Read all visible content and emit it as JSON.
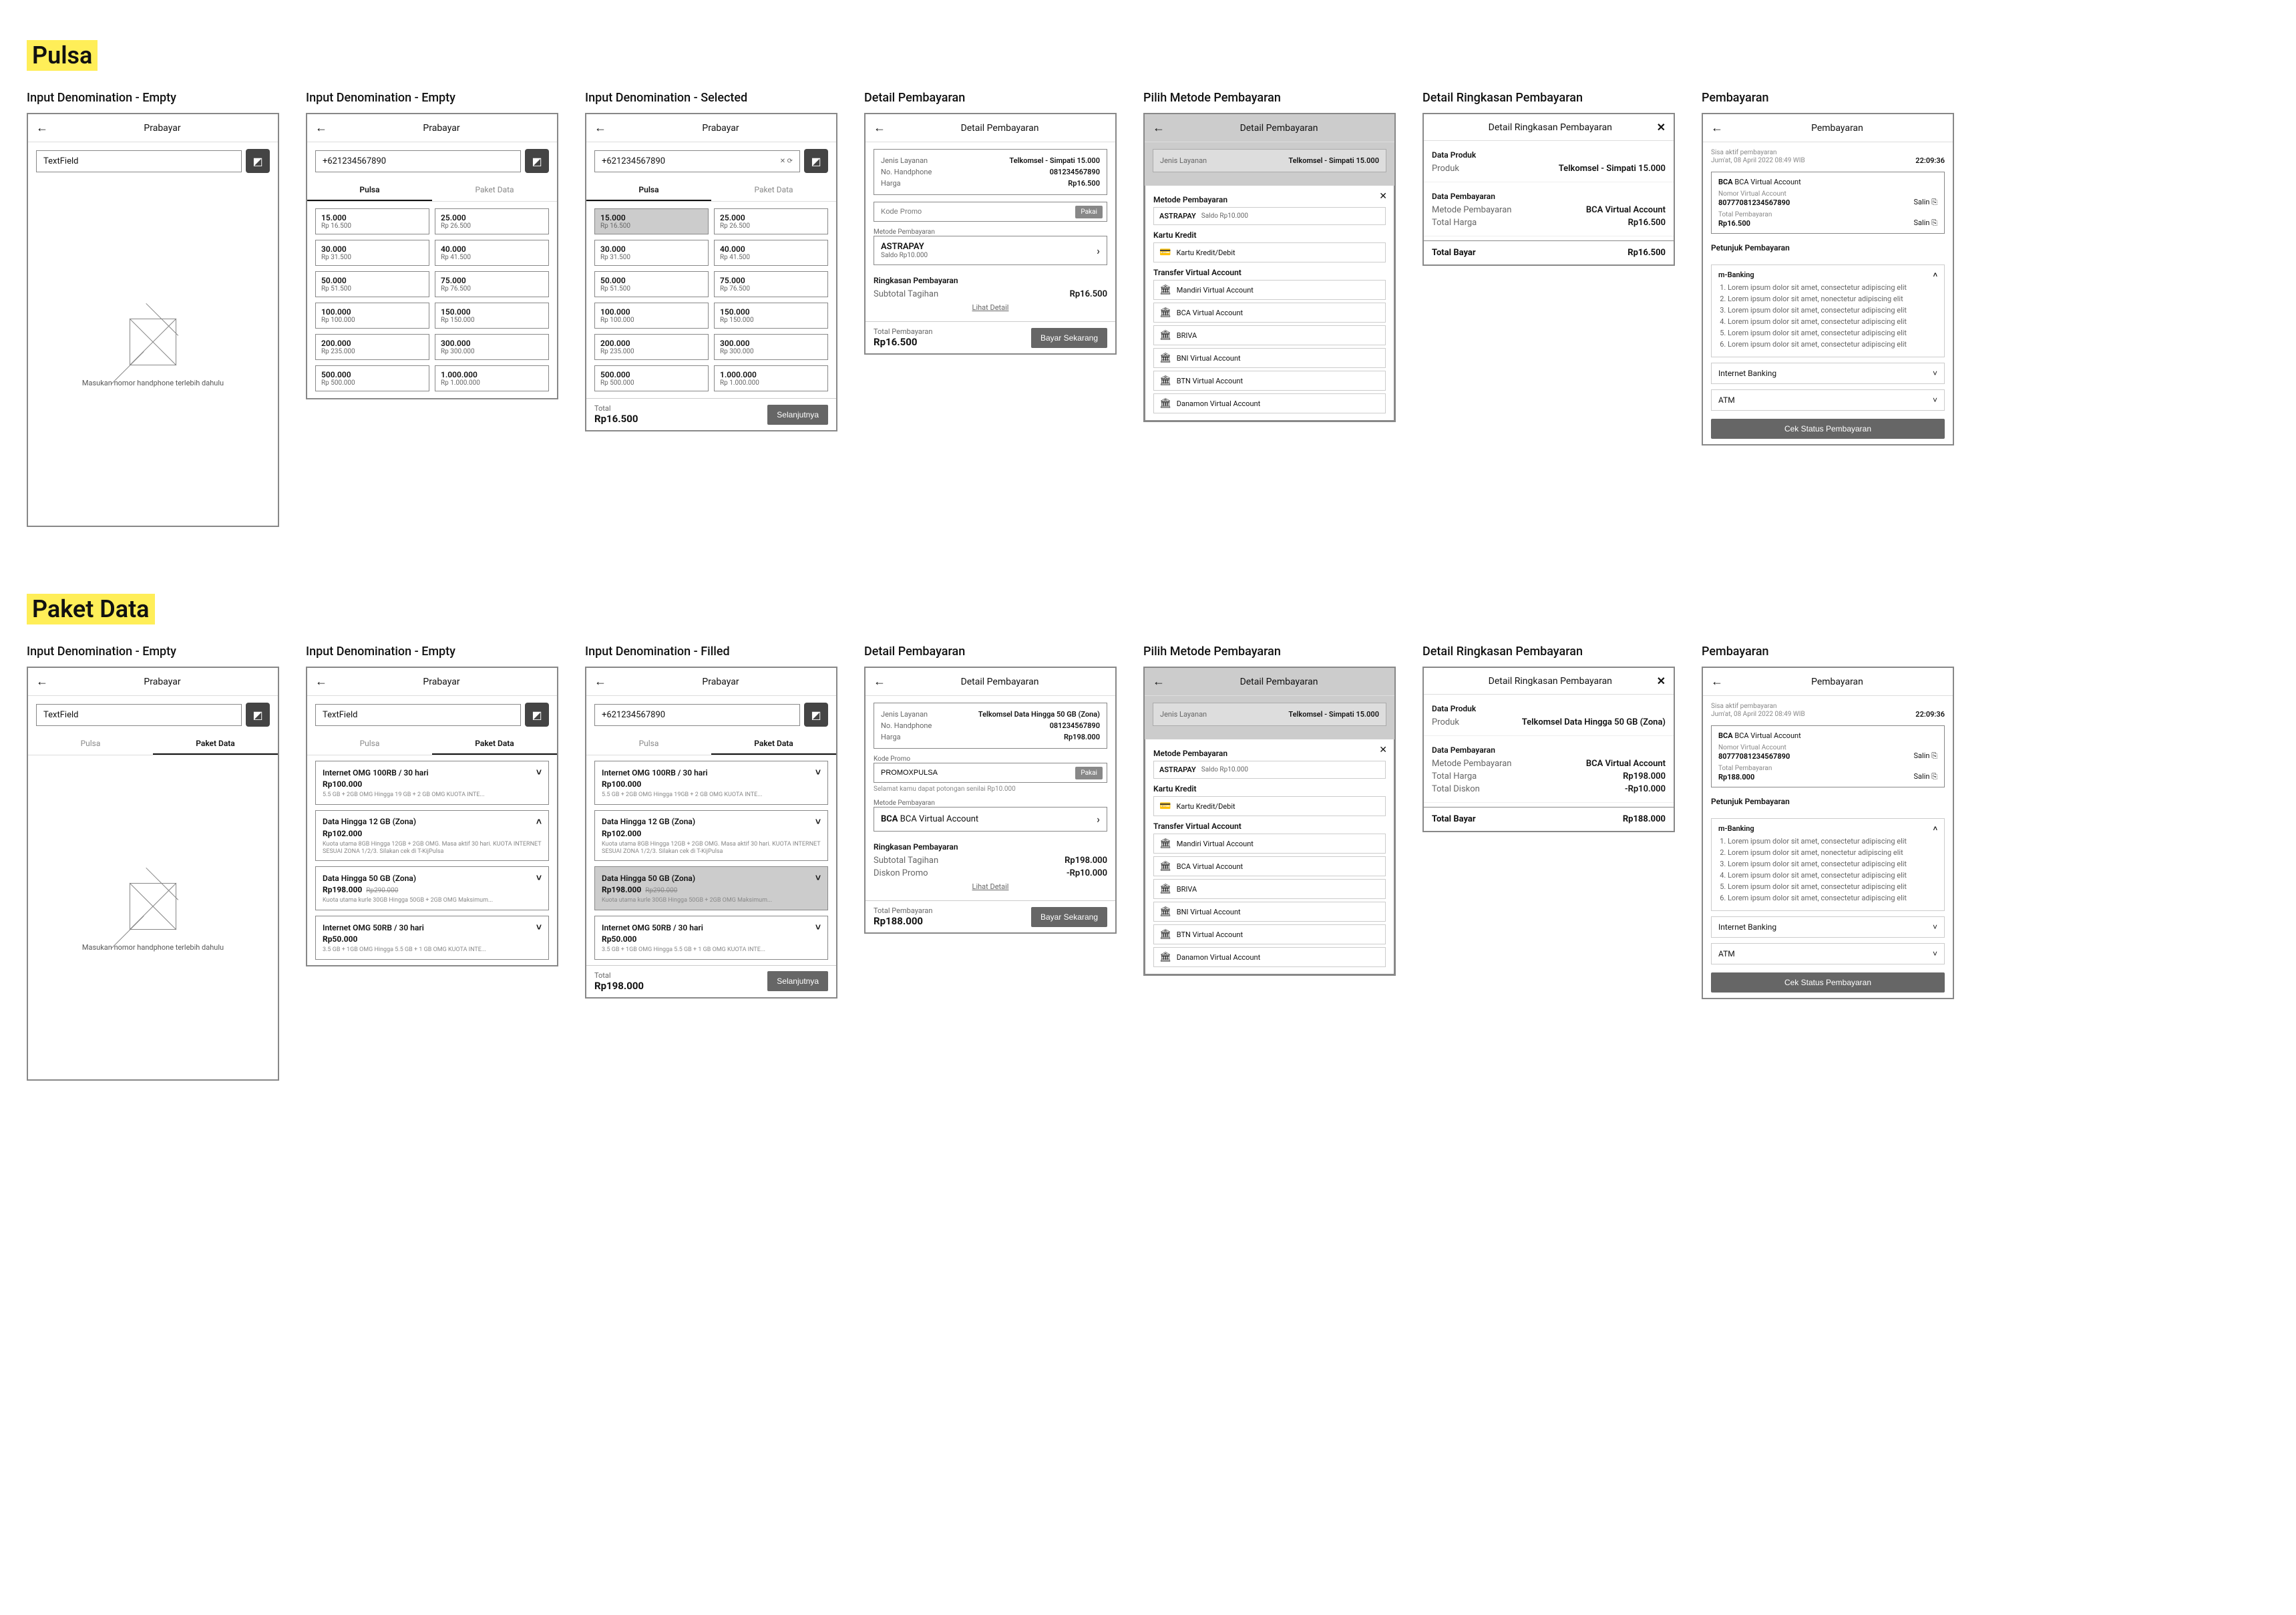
{
  "sections": {
    "pulsa": "Pulsa",
    "paket": "Paket Data"
  },
  "titles": {
    "empty": "Input Denomination - Empty",
    "selected": "Input Denomination - Selected",
    "filled": "Input Denomination - Filled",
    "detail": "Detail Pembayaran",
    "metode": "Pilih Metode Pembayaran",
    "ringkasan": "Detail Ringkasan Pembayaran",
    "pay": "Pembayaran"
  },
  "appbar": {
    "prabayar": "Prabayar",
    "detail": "Detail Pembayaran",
    "ring": "Detail Ringkasan Pembayaran",
    "pay": "Pembayaran"
  },
  "input": {
    "placeholder": "TextField",
    "phone": "+621234567890",
    "clear": "✕ ⟳"
  },
  "tabs": {
    "pulsa": "Pulsa",
    "data": "Paket Data"
  },
  "empty": {
    "msg": "Masukan nomor handphone terlebih dahulu"
  },
  "denoms": [
    {
      "amt": "15.000",
      "price": "Rp 16.500"
    },
    {
      "amt": "25.000",
      "price": "Rp 26.500"
    },
    {
      "amt": "30.000",
      "price": "Rp 31.500"
    },
    {
      "amt": "40.000",
      "price": "Rp 41.500"
    },
    {
      "amt": "50.000",
      "price": "Rp 51.500"
    },
    {
      "amt": "75.000",
      "price": "Rp 76.500"
    },
    {
      "amt": "100.000",
      "price": "Rp 100.000"
    },
    {
      "amt": "150.000",
      "price": "Rp 150.000"
    },
    {
      "amt": "200.000",
      "price": "Rp 235.000"
    },
    {
      "amt": "300.000",
      "price": "Rp 300.000"
    },
    {
      "amt": "500.000",
      "price": "Rp 500.000"
    },
    {
      "amt": "1.000.000",
      "price": "Rp 1.000.000"
    }
  ],
  "bbar": {
    "total": "Total",
    "val": "Rp16.500",
    "next": "Selanjutnya"
  },
  "detail": {
    "jenis": "Jenis Layanan",
    "jenisV": "Telkomsel - Simpati 15.000",
    "no": "No. Handphone",
    "noV": "081234567890",
    "harga": "Harga",
    "hargaV": "Rp16.500",
    "promo": "Kode Promo",
    "pakai": "Pakai",
    "metodeLabel": "Metode Pembayaran",
    "astra": "ASTRAPAY",
    "saldo": "Saldo Rp10.000",
    "ringHead": "Ringkasan Pembayaran",
    "subtotal": "Subtotal Tagihan",
    "subtotalV": "Rp16.500",
    "lihat": "Lihat Detail",
    "totalLab": "Total Pembayaran",
    "totalV": "Rp16.500",
    "bayar": "Bayar Sekarang"
  },
  "metode": {
    "title": "Metode Pembayaran",
    "astra": "ASTRAPAY",
    "saldo": "Saldo Rp10.000",
    "kk": "Kartu Kredit",
    "kkd": "Kartu Kredit/Debit",
    "tva": "Transfer Virtual Account",
    "tvaList": [
      "Mandiri Virtual Account",
      "BCA Virtual Account",
      "BRIVA",
      "BNI Virtual Account",
      "BTN Virtual Account",
      "Danamon Virtual Account"
    ]
  },
  "ring": {
    "dp": "Data Produk",
    "produk": "Produk",
    "produkV": "Telkomsel - Simpati 15.000",
    "dby": "Data Pembayaran",
    "mp": "Metode Pembayaran",
    "mpV": "BCA Virtual Account",
    "th": "Total Harga",
    "thV": "Rp16.500",
    "tb": "Total Bayar",
    "tbV": "Rp16.500"
  },
  "pay": {
    "sisa": "Sisa aktif pembayaran",
    "tstamp": "Jum'at, 08 April 2022 08:49 WIB",
    "timer": "22:09:36",
    "bca": "BCA",
    "bcaL": "BCA Virtual Account",
    "nva": "Nomor Virtual Account",
    "nvaV": "80777081234567890",
    "salin": "Salin",
    "tp": "Total Pembayaran",
    "tpV": "Rp16.500",
    "pet": "Petunjuk Pembayaran",
    "mbank": "m-Banking",
    "ibank": "Internet Banking",
    "atm": "ATM",
    "steps": [
      "Lorem ipsum dolor sit amet, consectetur adipiscing elit",
      "Lorem ipsum dolor sit amet, nonectetur adipiscing elit",
      "Lorem ipsum dolor sit amet, consectetur adipiscing elit",
      "Lorem ipsum dolor sit amet, consectetur adipiscing elit",
      "Lorem ipsum dolor sit amet, consectetur adipiscing elit",
      "Lorem ipsum dolor sit amet, consectetur adipiscing elit"
    ],
    "cek": "Cek Status Pembayaran"
  },
  "paket": {
    "list": [
      {
        "name": "Internet OMG 100RB / 30 hari",
        "price": "Rp100.000",
        "desc": "5.5 GB + 2GB OMG Hingga 19 GB + 2 GB OMG KUOTA INTE...",
        "open": false
      },
      {
        "name": "Data Hingga 12 GB (Zona)",
        "price": "Rp102.000",
        "desc": "Kuota utama 8GB Hingga 12GB + 2GB OMG. Masa aktif 30 hari. KUOTA INTERNET SESUAI ZONA 1/2/3. Silakan cek di T-KijPulsa",
        "open": true
      },
      {
        "name": "Data Hingga 50 GB (Zona)",
        "price": "Rp198.000",
        "strike": "Rp290.000",
        "desc": "Kuota utama kurle 30GB Hingga 50GB + 2GB OMG Maksimum...",
        "open": false
      },
      {
        "name": "Internet OMG 50RB / 30 hari",
        "price": "Rp50.000",
        "desc": "3.5 GB + 1GB OMG Hingga 5.5 GB + 1 GB OMG KUOTA INTE...",
        "open": false
      }
    ],
    "filled": [
      {
        "name": "Internet OMG 100RB / 30 hari",
        "price": "Rp100.000",
        "desc": "5.5 GB + 2GB OMG Hingga 19GB + 2 GB OMG KUOTA INTE..."
      },
      {
        "name": "Data Hingga 12 GB (Zona)",
        "price": "Rp102.000",
        "desc": "Kuota utama 8GB Hingga 12GB + 2GB OMG. Masa aktif 30 hari. KUOTA INTERNET SESUAI ZONA 1/2/3. Silakan cek di T-KijPulsa"
      },
      {
        "name": "Data Hingga 50 GB (Zona)",
        "price": "Rp198.000",
        "strike": "Rp290.000",
        "sel": true,
        "desc": "Kuota utama kurle 30GB Hingga 50GB + 2GB OMG Maksimum..."
      },
      {
        "name": "Internet OMG 50RB / 30 hari",
        "price": "Rp50.000",
        "desc": "3.5 GB + 1GB OMG Hingga 5.5 GB + 1 GB OMG KUOTA INTE..."
      }
    ],
    "totalV": "Rp198.000"
  },
  "dpaket": {
    "jenisV": "Telkomsel Data Hingga 50 GB (Zona)",
    "hargaV": "Rp198.000",
    "promoVal": "PROMOXPULSA",
    "hint": "Selamat kamu dapat potongan senilai Rp10.000",
    "bcaline": "BCA Virtual Account",
    "sub": "Rp198.000",
    "diskon": "Diskon Promo",
    "diskonV": "-Rp10.000",
    "total": "Rp188.000"
  },
  "ringP": {
    "produkV": "Telkomsel Data Hingga 50 GB (Zona)",
    "th": "Rp198.000",
    "td": "Total Diskon",
    "tdV": "-Rp10.000",
    "tb": "Rp188.000"
  },
  "payP": {
    "tpV": "Rp188.000"
  },
  "icons": {
    "copy": "⎘"
  }
}
